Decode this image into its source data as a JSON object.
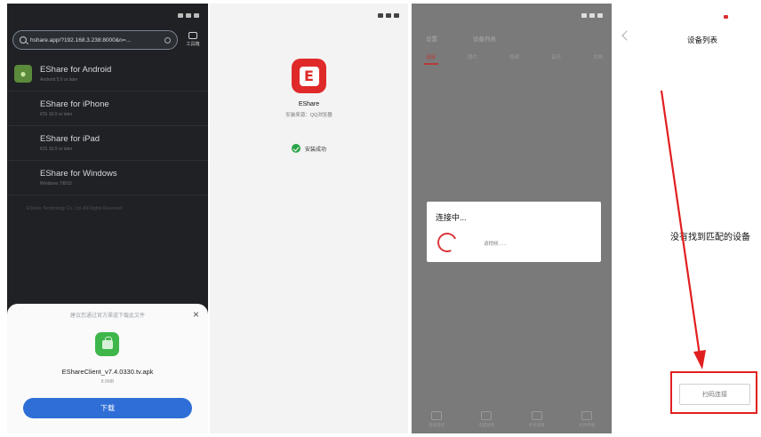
{
  "phone1": {
    "url": "hshare.app/?192.168.3.238:8000&n=...",
    "toolbox_label": "工具箱",
    "downloads": [
      {
        "title": "EShare for Android",
        "subtitle": "Android 5.0 or later"
      },
      {
        "title": "EShare for iPhone",
        "subtitle": "iOS 10.0 or later"
      },
      {
        "title": "EShare for iPad",
        "subtitle": "iOS 10.0 or later"
      },
      {
        "title": "EShare for Windows",
        "subtitle": "Windows 7/8/10"
      }
    ],
    "footer_note": "EShare Technology Co. Ltd. All Rights Reserved",
    "sheet": {
      "warning": "建议您通过官方渠道下载此文件",
      "filename": "EShareClient_v7.4.0330.tv.apk",
      "filesize": "8.9MB",
      "download_label": "下载"
    }
  },
  "phone2": {
    "app_name": "EShare",
    "source": "安装来源：QQ浏览器",
    "success": "安装成功"
  },
  "phone3": {
    "top_left": "设置",
    "top_right": "设备列表",
    "tabs": [
      "连接",
      "图片",
      "视频",
      "音乐",
      "文档"
    ],
    "dialog_title": "连接中...",
    "dialog_wait": "请稍候......",
    "bottom": [
      "电视遥控",
      "电脑镜像",
      "手机镜像",
      "文件传输"
    ]
  },
  "phone4": {
    "title": "设备列表",
    "empty": "没有找到匹配的设备",
    "scan_label": "扫码连接"
  },
  "colors": {
    "accent_red": "#e02a2a",
    "download_blue": "#2e6ed6",
    "success_green": "#2ca44a"
  }
}
